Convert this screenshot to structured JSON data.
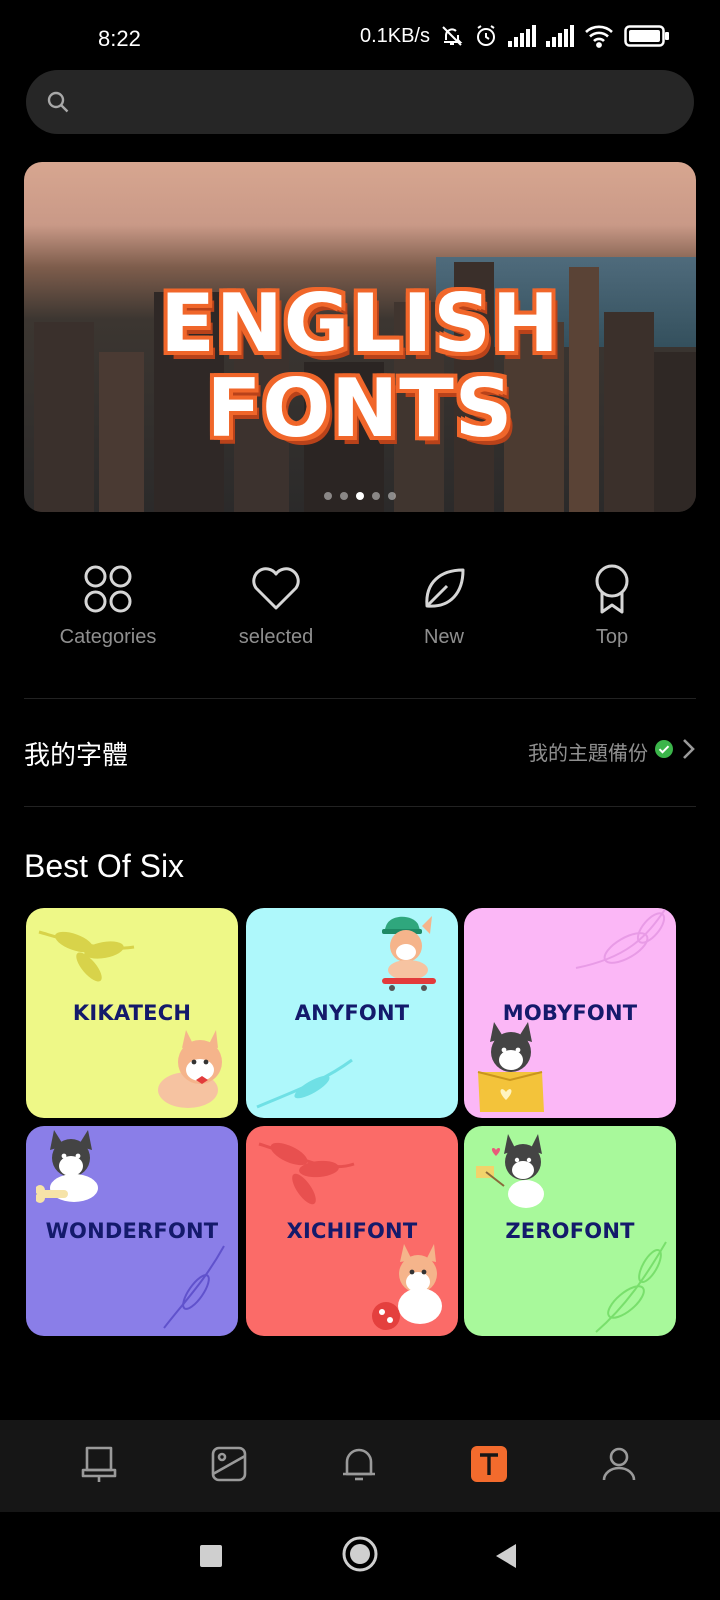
{
  "status_bar": {
    "time": "8:22",
    "net_speed": "0.1KB/s"
  },
  "search": {
    "placeholder": ""
  },
  "banner": {
    "title_line1": "ENGLISH",
    "title_line2": "FONTS",
    "page_count": 5,
    "active_page": 3
  },
  "quick_nav": {
    "items": [
      {
        "label": "Categories",
        "icon": "categories-icon"
      },
      {
        "label": "selected",
        "icon": "heart-icon"
      },
      {
        "label": "New",
        "icon": "leaf-icon"
      },
      {
        "label": "Top",
        "icon": "award-icon"
      }
    ]
  },
  "my_fonts": {
    "title": "我的字體",
    "backup_label": "我的主題備份"
  },
  "best_of_six": {
    "title": "Best Of Six",
    "tiles": [
      {
        "name": "KIKATECH",
        "color": "#eef887"
      },
      {
        "name": "ANYFONT",
        "color": "#aef8fb"
      },
      {
        "name": "MOBYFONT",
        "color": "#fbb7f6"
      },
      {
        "name": "WONDERFONT",
        "color": "#8a7ee8"
      },
      {
        "name": "XICHIFONT",
        "color": "#fb6b68"
      },
      {
        "name": "ZEROFONT",
        "color": "#a8f99b"
      }
    ]
  },
  "bottom_nav": {
    "tabs": [
      "theme-icon",
      "wallpaper-icon",
      "bell-icon",
      "font-icon",
      "profile-icon"
    ],
    "active": "font-icon",
    "accent": "#f36b2d"
  }
}
